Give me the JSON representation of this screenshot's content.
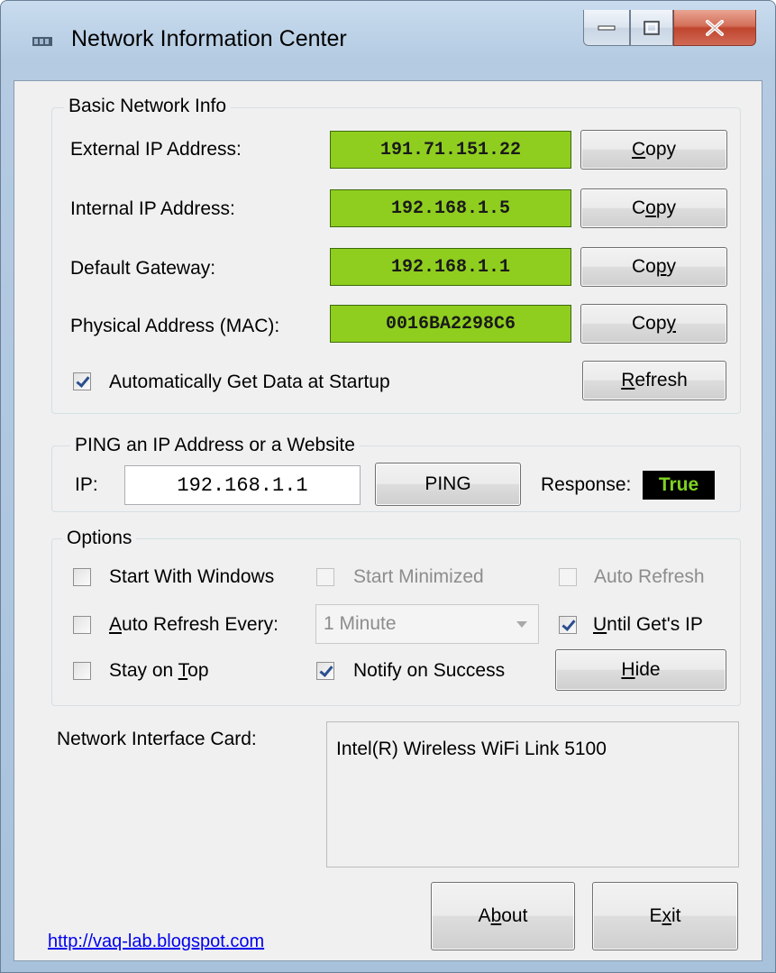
{
  "window": {
    "title": "Network Information Center"
  },
  "basic": {
    "legend": "Basic Network Info",
    "rows": [
      {
        "label": "External IP Address:",
        "value": "191.71.151.22",
        "button": "Copy",
        "accel_pre": "",
        "accel": "C",
        "accel_post": "opy"
      },
      {
        "label": "Internal IP Address:",
        "value": "192.168.1.5",
        "button": "Copy",
        "accel_pre": "C",
        "accel": "o",
        "accel_post": "py"
      },
      {
        "label": "Default Gateway:",
        "value": "192.168.1.1",
        "button": "Copy",
        "accel_pre": "Co",
        "accel": "p",
        "accel_post": "y"
      },
      {
        "label": "Physical Address (MAC):",
        "value": "0016BA2298C6",
        "button": "Copy",
        "accel_pre": "Cop",
        "accel": "y",
        "accel_post": ""
      }
    ],
    "auto_get_label": "Automatically Get Data at Startup",
    "auto_get_checked": true,
    "refresh": {
      "pre": "",
      "accel": "R",
      "post": "efresh"
    }
  },
  "ping": {
    "legend": "PING an IP Address or a Website",
    "ip_label": "IP:",
    "ip_value": "192.168.1.1",
    "button": "PING",
    "response_label": "Response:",
    "response_value": "True"
  },
  "options": {
    "legend": "Options",
    "start_with_windows": "Start With Windows",
    "start_minimized": "Start Minimized",
    "auto_refresh": "Auto Refresh",
    "auto_refresh_every": {
      "pre": "",
      "accel": "A",
      "post": "uto Refresh Every:"
    },
    "interval_value": "1 Minute",
    "until_gets_ip": {
      "pre": "",
      "accel": "U",
      "post": "ntil Get's IP"
    },
    "stay_on_top": {
      "pre": "Stay on ",
      "accel": "T",
      "post": "op"
    },
    "notify_on_success": "Notify on Success",
    "hide": {
      "pre": "",
      "accel": "H",
      "post": "ide"
    }
  },
  "nic": {
    "label": "Network Interface Card:",
    "value": "Intel(R) Wireless WiFi Link 5100"
  },
  "footer": {
    "link": "http://vaq-lab.blogspot.com",
    "about": {
      "pre": "A",
      "accel": "b",
      "post": "out"
    },
    "exit": {
      "pre": "E",
      "accel": "x",
      "post": "it"
    }
  }
}
